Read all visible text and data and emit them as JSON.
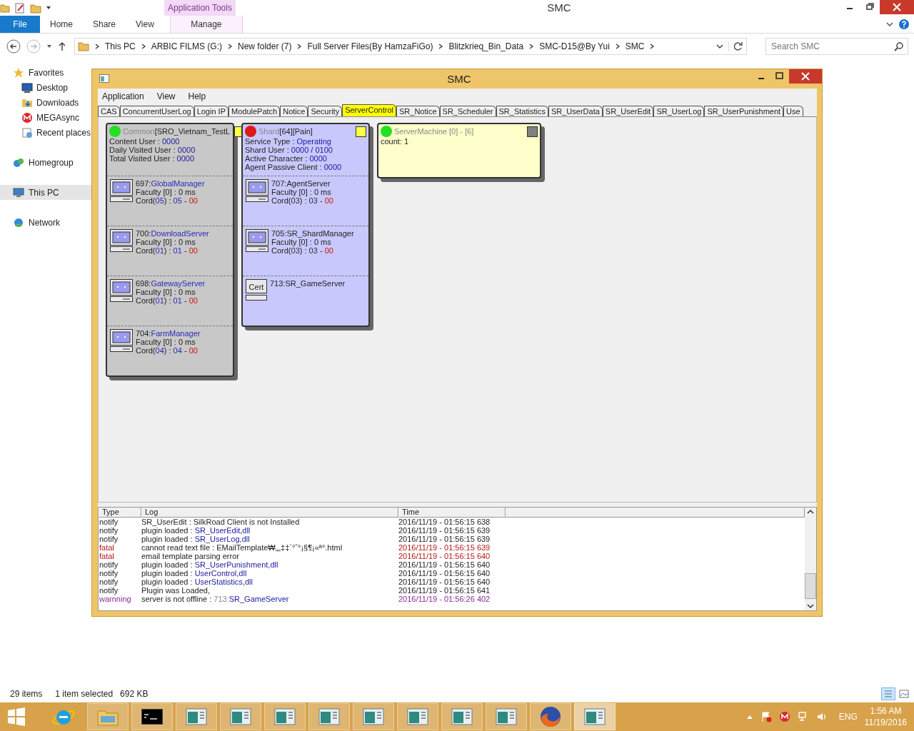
{
  "explorer": {
    "title": "SMC",
    "contextual_tab": "Application Tools",
    "ribbon_tabs": [
      {
        "label": "File",
        "kind": "file",
        "selected": false
      },
      {
        "label": "Home",
        "kind": "tab",
        "selected": false
      },
      {
        "label": "Share",
        "kind": "tab",
        "selected": false
      },
      {
        "label": "View",
        "kind": "tab",
        "selected": false
      },
      {
        "label": "Manage",
        "kind": "contextual",
        "selected": false
      }
    ],
    "address": [
      "This PC",
      "ARBIC FILMS (G:)",
      "New folder (7)",
      "Full Server Files(By HamzaFiGo)",
      "Blitzkrieq_Bin_Data",
      "SMC-D15@By Yui",
      "SMC"
    ],
    "search": {
      "placeholder": "Search SMC"
    },
    "sidebar": [
      {
        "label": "Favorites",
        "kind": "star",
        "selected": false,
        "children": [
          {
            "label": "Desktop",
            "kind": "desktop",
            "selected": false
          },
          {
            "label": "Downloads",
            "kind": "download",
            "selected": false
          },
          {
            "label": "MEGAsync",
            "kind": "mega",
            "selected": false
          },
          {
            "label": "Recent places",
            "kind": "recent",
            "selected": false
          }
        ]
      },
      {
        "label": "Homegroup",
        "kind": "homegroup",
        "selected": false
      },
      {
        "label": "This PC",
        "kind": "pc",
        "selected": true
      },
      {
        "label": "Network",
        "kind": "network",
        "selected": false
      }
    ],
    "status_bar": {
      "count": "29 items",
      "selection": "1 item selected",
      "size": "692 KB"
    }
  },
  "smc": {
    "title": "SMC",
    "menu": [
      "Application",
      "View",
      "Help"
    ],
    "tabs": [
      {
        "label": "CAS",
        "selected": false
      },
      {
        "label": "ConcurrentUserLog",
        "selected": false
      },
      {
        "label": "Login IP",
        "selected": false
      },
      {
        "label": "ModulePatch",
        "selected": false
      },
      {
        "label": "Notice",
        "selected": false
      },
      {
        "label": "Security",
        "selected": false
      },
      {
        "label": "ServerControl",
        "selected": true
      },
      {
        "label": "SR_Notice",
        "selected": false
      },
      {
        "label": "SR_Scheduler",
        "selected": false
      },
      {
        "label": "SR_Statistics",
        "selected": false
      },
      {
        "label": "SR_UserData",
        "selected": false
      },
      {
        "label": "SR_UserEdit",
        "selected": false
      },
      {
        "label": "SR_UserLog",
        "selected": false
      },
      {
        "label": "SR_UserPunishment",
        "selected": false
      },
      {
        "label": "Use",
        "selected": false
      }
    ],
    "cards": [
      {
        "kind": "common",
        "color": "#22e022",
        "title_prefix": "Common",
        "title": "[SRO_Vietnam_TestL",
        "info": [
          {
            "label": "Content User : ",
            "value": "0000"
          },
          {
            "label": "Daily Visited User : ",
            "value": "0000"
          },
          {
            "label": "Total Visited User : ",
            "value": "0000"
          }
        ],
        "servers": [
          {
            "kind": "monitor",
            "id": "697:",
            "name": "GlobalManager",
            "faculty": "Faculty [0] : 0 ms",
            "cord_parts": [
              "Cord(",
              "05",
              ") : ",
              "05",
              " - ",
              "00"
            ]
          },
          {
            "kind": "monitor",
            "id": "700:",
            "name": "DownloadServer",
            "faculty": "Faculty [0] : 0 ms",
            "cord_parts": [
              "Cord(",
              "01",
              ") : ",
              "01",
              " - ",
              "00"
            ]
          },
          {
            "kind": "monitor",
            "id": "698:",
            "name": "GatewayServer",
            "faculty": "Faculty [0] : 0 ms",
            "cord_parts": [
              "Cord(",
              "01",
              ") : ",
              "01",
              " - ",
              "00"
            ]
          },
          {
            "kind": "monitor",
            "id": "704:",
            "name": "FarmManager",
            "faculty": "Faculty [0] : 0 ms",
            "cord_parts": [
              "Cord(",
              "04",
              ") : ",
              "04",
              " - ",
              "00"
            ]
          }
        ]
      },
      {
        "kind": "shard",
        "color": "#e01818",
        "title_prefix": "Shard",
        "title": "[64][Pain]",
        "info": [
          {
            "label": "Service Type : ",
            "value": "Operating"
          },
          {
            "label": "Shard User : ",
            "value": "0000 / 0100"
          },
          {
            "label": "Active Character : ",
            "value": "0000"
          },
          {
            "label": "Agent Passive Client : ",
            "value": "0000"
          }
        ],
        "servers": [
          {
            "kind": "monitor",
            "id": "707:",
            "name": "AgentServer",
            "faculty": "Faculty [0] : 0 ms",
            "cord_parts": [
              "Cord(",
              "03",
              ") : ",
              "03",
              " - ",
              "00"
            ]
          },
          {
            "kind": "monitor",
            "id": "705:",
            "name": "SR_ShardManager",
            "faculty": "Faculty [0] : 0 ms",
            "cord_parts": [
              "Cord(",
              "03",
              ") : ",
              "03",
              " - ",
              "00"
            ]
          },
          {
            "kind": "cert",
            "icon_text": "Cert",
            "id": "713:",
            "name": "SR_GameServer"
          }
        ]
      },
      {
        "kind": "machine",
        "color": "#22e022",
        "title_prefix": "ServerMachine",
        "title": " [0] - [6]",
        "info": [
          {
            "label": "count: 1"
          }
        ]
      }
    ],
    "log": {
      "columns": [
        "Type",
        "Log",
        "Time"
      ],
      "rows": [
        {
          "type": "notify",
          "message": "SR_UserEdit : SilkRoad Client is not Installed",
          "time": "2016/11/19 - 01:56:15 638"
        },
        {
          "type": "notify",
          "message": "plugin loaded : ",
          "target": "SR_UserEdit,dll",
          "time": "2016/11/19 - 01:56:15 639"
        },
        {
          "type": "notify",
          "message": "plugin loaded : ",
          "target": "SR_UserLog,dll",
          "time": "2016/11/19 - 01:56:15 639"
        },
        {
          "type": "fatal",
          "message": "cannot read text file : EMailTemplate₩„„‡‡´°ˆ°¡§¶¡«ª°.html",
          "time": "2016/11/19 - 01:56:15 639"
        },
        {
          "type": "fatal",
          "message": "email template parsing error",
          "time": "2016/11/19 - 01:56:15 640"
        },
        {
          "type": "notify",
          "message": "plugin loaded : ",
          "target": "SR_UserPunishment,dll",
          "time": "2016/11/19 - 01:56:15 640"
        },
        {
          "type": "notify",
          "message": "plugin loaded : ",
          "target": "UserControl,dll",
          "time": "2016/11/19 - 01:56:15 640"
        },
        {
          "type": "notify",
          "message": "plugin loaded : ",
          "target": "UserStatistics,dll",
          "time": "2016/11/19 - 01:56:15 640"
        },
        {
          "type": "notify",
          "message": "Plugin was Loaded,",
          "time": "2016/11/19 - 01:56:15 641"
        },
        {
          "type": "warnning",
          "message": "server is not offline : ",
          "target_id": "713:",
          "target": "SR_GameServer",
          "time": "2016/11/19 - 01:56:26 402"
        }
      ]
    }
  },
  "taskbar": {
    "apps": [
      {
        "kind": "ie",
        "selected": false
      },
      {
        "kind": "explorer",
        "selected": false
      },
      {
        "kind": "cmd",
        "selected": false
      },
      {
        "kind": "window",
        "selected": false
      },
      {
        "kind": "window",
        "selected": false
      },
      {
        "kind": "window",
        "selected": false
      },
      {
        "kind": "window",
        "selected": false
      },
      {
        "kind": "window",
        "selected": false
      },
      {
        "kind": "window",
        "selected": false
      },
      {
        "kind": "window",
        "selected": false
      },
      {
        "kind": "window",
        "selected": false
      },
      {
        "kind": "firefox",
        "selected": false
      },
      {
        "kind": "window",
        "selected": true
      }
    ],
    "language": "ENG",
    "time": "1:56 AM",
    "date": "11/19/2016"
  }
}
